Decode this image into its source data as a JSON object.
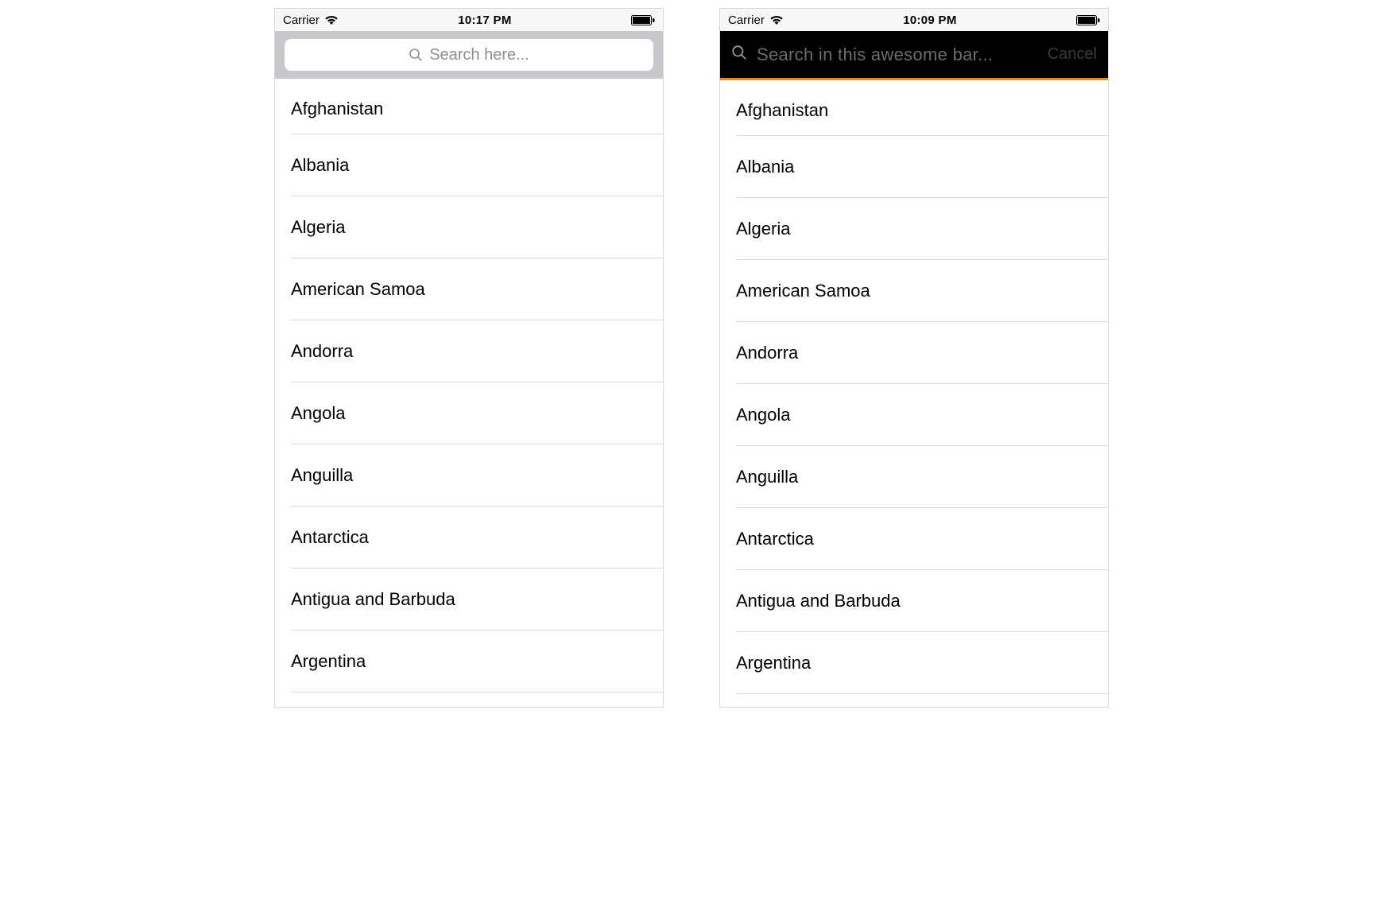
{
  "left": {
    "status": {
      "carrier": "Carrier",
      "time": "10:17 PM"
    },
    "search": {
      "placeholder": "Search here..."
    },
    "rows": [
      "Afghanistan",
      "Albania",
      "Algeria",
      "American Samoa",
      "Andorra",
      "Angola",
      "Anguilla",
      "Antarctica",
      "Antigua and Barbuda",
      "Argentina"
    ]
  },
  "right": {
    "status": {
      "carrier": "Carrier",
      "time": "10:09 PM"
    },
    "search": {
      "placeholder": "Search in this awesome bar...",
      "cancel": "Cancel"
    },
    "accent": "#e58a1f",
    "rows": [
      "Afghanistan",
      "Albania",
      "Algeria",
      "American Samoa",
      "Andorra",
      "Angola",
      "Anguilla",
      "Antarctica",
      "Antigua and Barbuda",
      "Argentina"
    ]
  }
}
